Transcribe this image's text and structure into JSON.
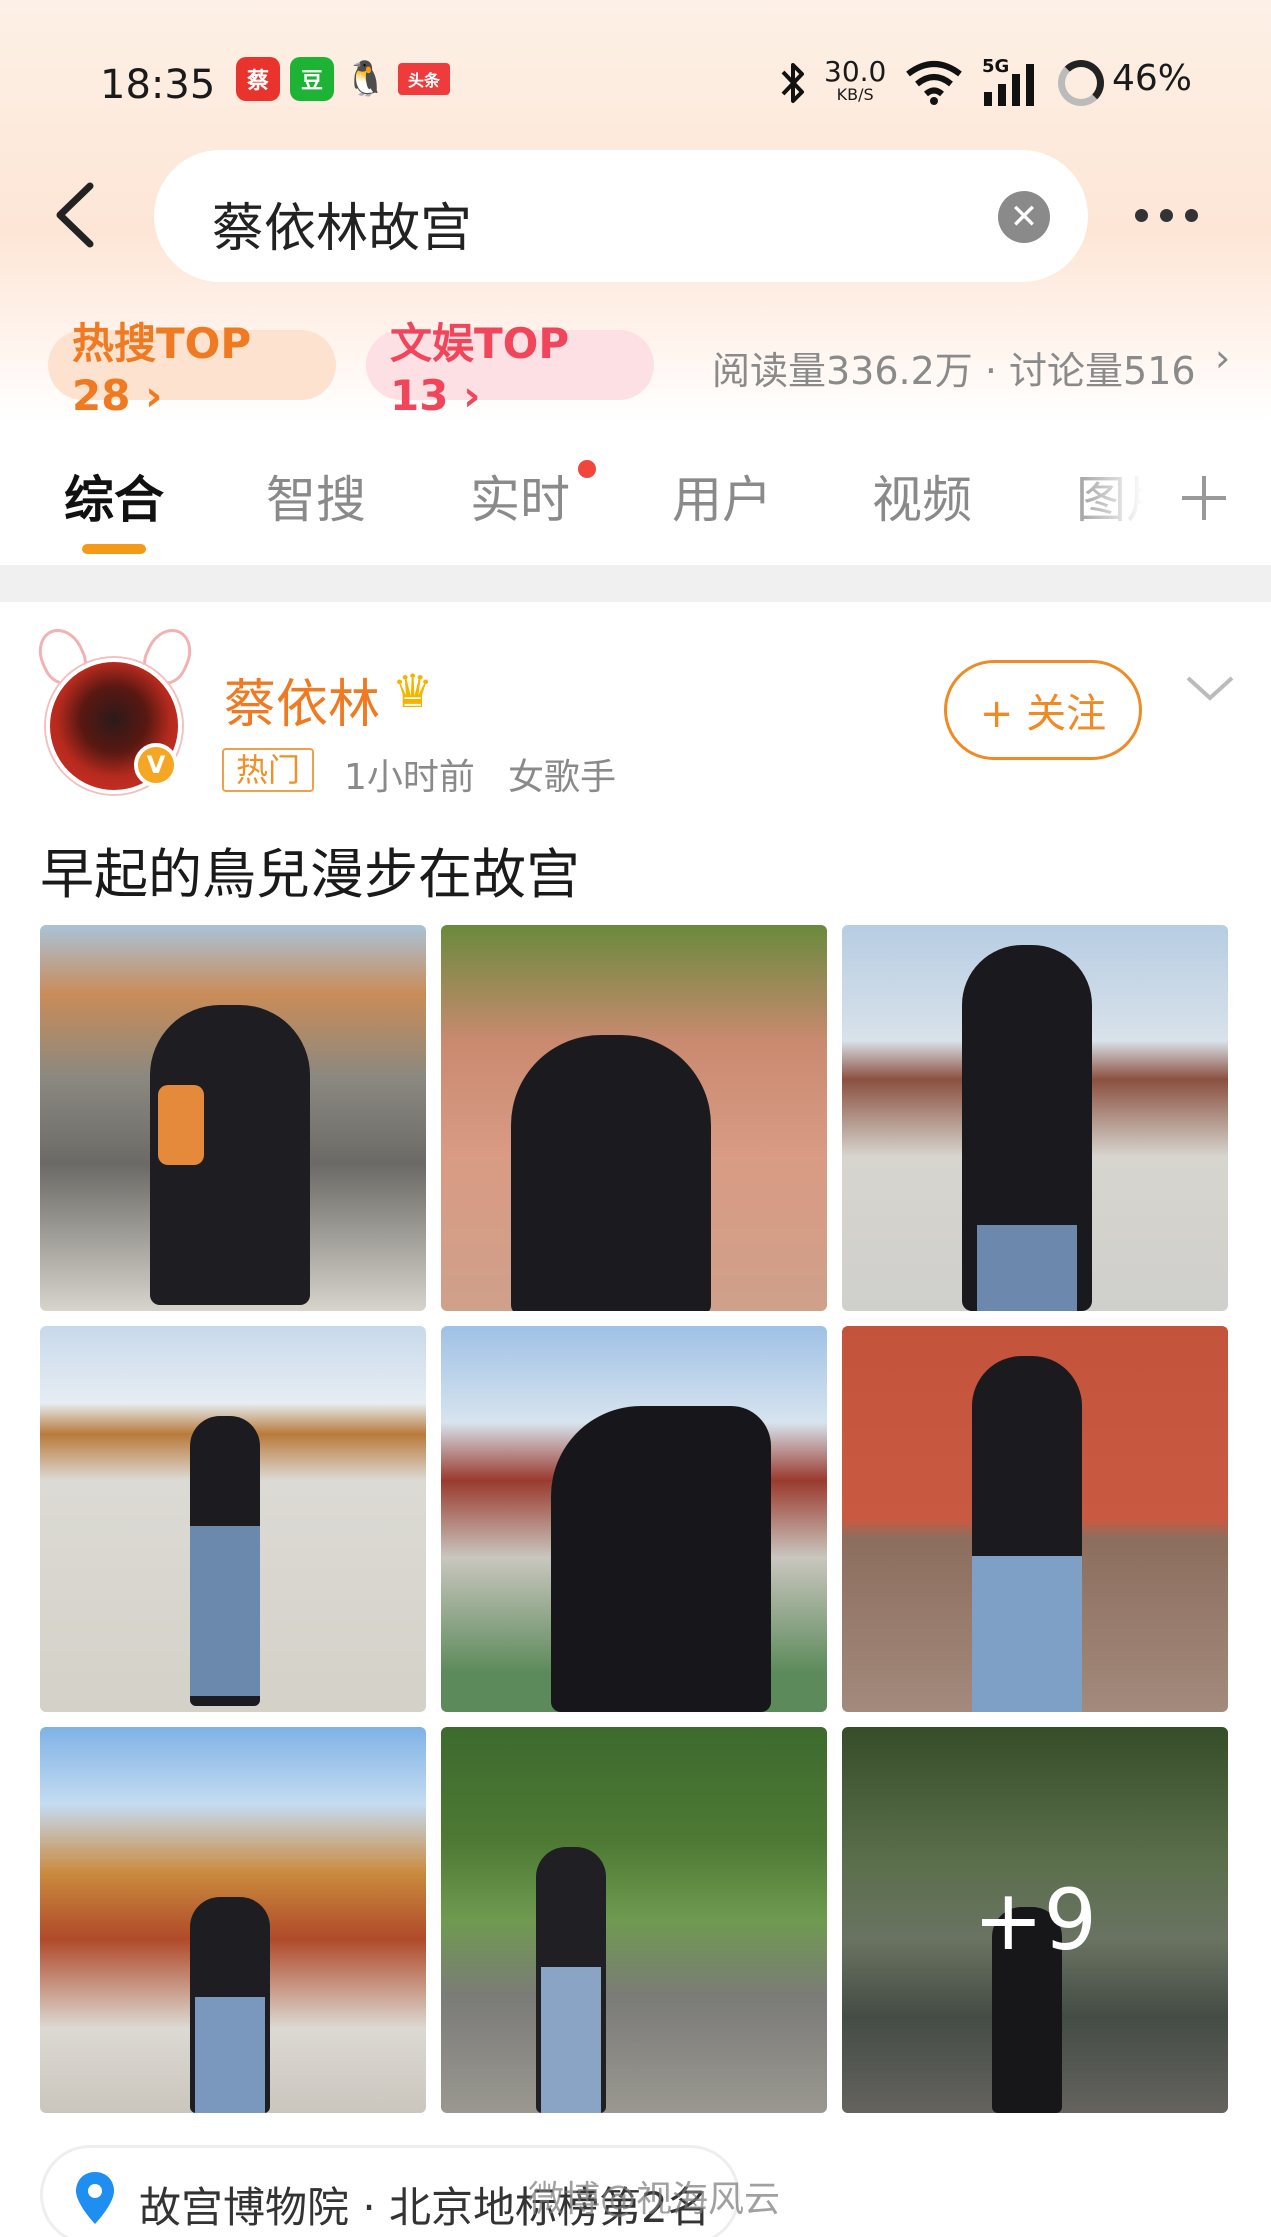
{
  "status_bar": {
    "time": "18:35",
    "apps": [
      {
        "name": "weibo-app-icon",
        "label": "蔡",
        "color": "#e8342c"
      },
      {
        "name": "douban-app-icon",
        "label": "豆",
        "color": "#1db334"
      },
      {
        "name": "qq-app-icon",
        "label": "🐧",
        "color": "transparent"
      },
      {
        "name": "toutiao-app-icon",
        "label": "头条",
        "color": "#ef3b3b"
      }
    ],
    "net_speed_value": "30.0",
    "net_speed_unit": "KB/S",
    "signal_label": "5G",
    "battery": "46%"
  },
  "search": {
    "query": "蔡依林故宫"
  },
  "badges": {
    "hot": "热搜TOP 28 ›",
    "ent": "文娱TOP 13 ›"
  },
  "stats": {
    "text": "阅读量336.2万 · 讨论量516",
    "chevron": "›"
  },
  "tabs": [
    {
      "label": "综合",
      "active": true
    },
    {
      "label": "智搜",
      "active": false
    },
    {
      "label": "实时",
      "active": false
    },
    {
      "label": "用户",
      "active": false
    },
    {
      "label": "视频",
      "active": false
    },
    {
      "label": "图片",
      "active": false
    }
  ],
  "post": {
    "username": "蔡依林",
    "crown": "♛",
    "verified_mark": "V",
    "hot_tag": "热门",
    "time": "1小时前",
    "bio": "女歌手",
    "follow_label": "+ 关注",
    "text": "早起的鳥兒漫步在故宫",
    "more_photos": "+9"
  },
  "location": {
    "text": "故宫博物院 · 北京地标榜第2名"
  },
  "watermark": "微博@视海风云",
  "colors": {
    "accent_orange": "#f07a22",
    "hot_red": "#f0455a",
    "tab_underline": "#f49a18"
  }
}
